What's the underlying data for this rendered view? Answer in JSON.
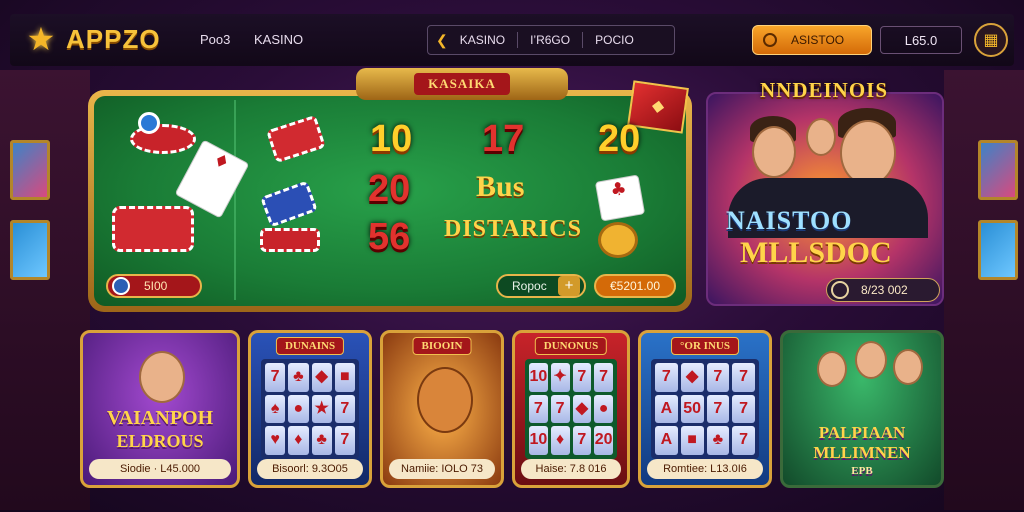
{
  "app": {
    "logo": "APPZO"
  },
  "nav": {
    "links": [
      "Poo3",
      "KASINO"
    ],
    "pill_items": [
      "KASINO",
      "I’R6GO",
      "POCIO"
    ],
    "cta_label": "ASISTOO",
    "balance": "L65.0"
  },
  "table": {
    "banner": "KASAIKA",
    "numbers": [
      "10",
      "17",
      "20",
      "20",
      "56"
    ],
    "headline": "Bus",
    "subhead": "DISTARICS",
    "pill_left": "5I00",
    "pill_mid": "Ropoc",
    "pill_right": "€5201.00"
  },
  "promo": {
    "title": "NNDEINOIS",
    "head1": "NAISTOO",
    "head2": "MLLSDOC",
    "pill_value": "8/23 002"
  },
  "tiles": [
    {
      "title": "",
      "name1": "VAIANPOH",
      "name2": "ELDROUS",
      "bar": "Siodie · L45.000",
      "color": "#6a2b9c",
      "reel": []
    },
    {
      "title": "DUNAINS",
      "bar": "Bisoorl: 9.3O05",
      "color": "#1f3c92",
      "reel": [
        "7",
        "♣",
        "◆",
        "■",
        "♠",
        "●",
        "★",
        "7",
        "♥",
        "♦",
        "♣",
        "7"
      ]
    },
    {
      "title": "BIOOIN",
      "bar": "Namiie: IOLO 73",
      "color": "#c06a1a",
      "reel": []
    },
    {
      "title": "DUNONUS",
      "bar": "Haise: 7.8 016",
      "color": "#0f6a3a",
      "reel": [
        "10",
        "✦",
        "7",
        "7",
        "7",
        "7",
        "◆",
        "●",
        "10",
        "♦",
        "7",
        "20"
      ]
    },
    {
      "title": "°OR INUS",
      "bar": "Romtiee: L13.0I6",
      "color": "#1f3c92",
      "reel": [
        "7",
        "◆",
        "7",
        "7",
        "A",
        "50",
        "7",
        "7",
        "A",
        "■",
        "♣",
        "7"
      ]
    },
    {
      "title": "",
      "name1": "PALPIAAN",
      "name2": "MLLIMNEN",
      "sub": "EPB",
      "bar": "",
      "color": "#2a7a3a",
      "reel": []
    }
  ],
  "colors": {
    "gold": "#f4b629",
    "felt": "#1a7c36",
    "red": "#a4161a"
  }
}
